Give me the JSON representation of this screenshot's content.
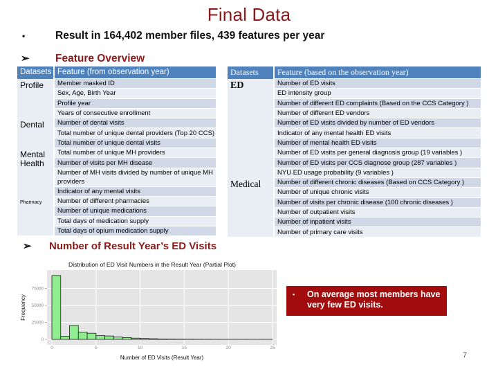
{
  "slide": {
    "title": "Final Data",
    "bullet": "Result in 164,402 member files, 439 features per year",
    "bullet_marker": "•",
    "arrow_marker": "➢",
    "section1": "Feature Overview",
    "section2": "Number of Result Year’s ED Visits",
    "callout_marker": "▪",
    "callout": "On average most members have very few ED visits.",
    "page_number": "7",
    "colors": {
      "title": "#8b1a1a",
      "table_header": "#4f81bd",
      "row_dark": "#d0d8e8",
      "row_light": "#e9edf4",
      "callout_bg": "#a30c0c",
      "bar_fill": "#90ee90"
    }
  },
  "table_left": {
    "headers": [
      "Datasets",
      "Feature (from observation year)"
    ],
    "groups": [
      {
        "dataset": "Profile",
        "features": [
          "Member masked ID",
          "Sex, Age, Birth Year",
          "Profile year",
          "Years of consecutive enrollment"
        ]
      },
      {
        "dataset": "Dental",
        "features": [
          "Number of dental visits",
          "Total number of unique dental providers (Top 20 CCS)",
          "Total number of unique dental visits"
        ]
      },
      {
        "dataset": "Mental Health",
        "features": [
          "Total number of unique MH providers",
          "Number of visits per MH disease",
          "Number of MH visits divided by number of unique MH providers",
          "Indicator of any mental visits"
        ]
      },
      {
        "dataset": "Pharmacy",
        "features": [
          "Number of different pharmacies",
          "Number of unique medications",
          "Total days of medication supply",
          "Total days of opium medication supply"
        ]
      }
    ]
  },
  "table_right": {
    "headers": [
      "Datasets",
      "Feature (based on the observation year)"
    ],
    "groups": [
      {
        "dataset": "ED",
        "features": [
          "Number of ED visits",
          "ED intensity group",
          "Number of different ED complaints (Based on the CCS Category )",
          "Number of different ED vendors",
          "Number of ED visits divided by number of ED vendors",
          "Indicator of any mental health ED visits",
          "Number of mental health ED visits",
          "Number of ED visits per general diagnosis group (19 variables )",
          "Number of ED visits per CCS diagnose group (287 variables )",
          "NYU ED usage probability  (9 variables )"
        ]
      },
      {
        "dataset": "Medical",
        "features": [
          "Number of different chronic diseases  (Based on CCS Category )",
          "Number of unique chronic visits",
          "Number of visits per chronic disease (100 chronic diseases )",
          "Number of outpatient visits",
          "Number of inpatient visits",
          "Number of primary care visits"
        ]
      }
    ]
  },
  "chart_data": {
    "type": "bar",
    "title": "Distribution of ED Visit Numbers in the Result Year (Partial Plot)",
    "xlabel": "Number of ED Visits (Result Year)",
    "ylabel": "Frequency",
    "xlim": [
      0,
      25
    ],
    "ylim": [
      0,
      100000
    ],
    "xticks": [
      0,
      5,
      10,
      15,
      20,
      25
    ],
    "yticks": [
      0,
      25000,
      50000,
      75000
    ],
    "ytick_labels": [
      "0",
      "25000",
      "50000",
      "75000"
    ],
    "bin_width": 1,
    "bin_starts": [
      0,
      1,
      2,
      3,
      4,
      5,
      6,
      7,
      8,
      9,
      10,
      11,
      12,
      13,
      14,
      15,
      16,
      17,
      18,
      19,
      20,
      21,
      22,
      23,
      24
    ],
    "values": [
      94000,
      4500,
      20500,
      10500,
      9000,
      5500,
      5000,
      3500,
      2600,
      1800,
      1300,
      900,
      600,
      450,
      350,
      280,
      220,
      170,
      130,
      100,
      80,
      60,
      50,
      40,
      30
    ],
    "grid": true,
    "background": "#e5e5e5"
  }
}
